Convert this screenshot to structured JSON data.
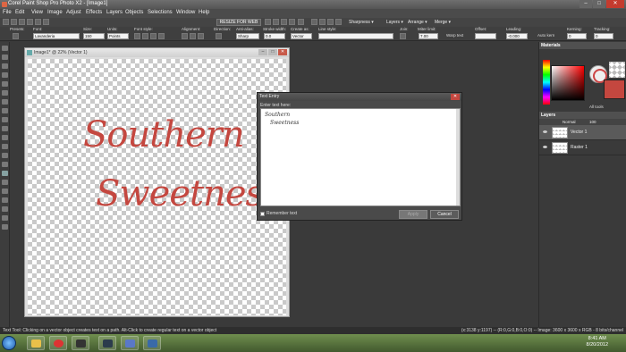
{
  "window": {
    "title": "Corel Paint Shop Pro Photo X2 - [Image1]",
    "min": "–",
    "max": "□",
    "close": "✕"
  },
  "menu": [
    "File",
    "Edit",
    "View",
    "Image",
    "Adjust",
    "Effects",
    "Layers",
    "Objects",
    "Selections",
    "Window",
    "Help"
  ],
  "toolbar1": {
    "resize_label": "RESIZE FOR WEB",
    "sharpness_label": "Sharpness ▾",
    "layers_label": "Layers ▾",
    "arrange_label": "Arrange ▾",
    "merge_label": "Merge ▾"
  },
  "tool_options": {
    "presets_label": "Presets:",
    "font_label": "Font:",
    "font_value": "Lavanderia",
    "size_label": "Size:",
    "size_value": "150",
    "units_label": "Units:",
    "units_value": "Points",
    "font_style_label": "Font style:",
    "alignment_label": "Alignment:",
    "direction_label": "Direction:",
    "antialias_label": "Anti-alias:",
    "antialias_value": "Sharp",
    "stroke_width_label": "Stroke width:",
    "stroke_width_value": "0.0",
    "create_as_label": "Create as:",
    "create_as_value": "Vector",
    "line_style_label": "Line style:",
    "join_label": "Join:",
    "miter_limit_label": "Miter limit:",
    "miter_limit_value": "7.00",
    "warp_text_label": "Warp text",
    "offset_label": "Offset:",
    "leading_label": "Leading:",
    "leading_value": "-0.000",
    "auto_kern_label": "Auto kern",
    "kerning_label": "Kerning:",
    "kerning_value": "0",
    "tracking_label": "Tracking:",
    "tracking_value": "0"
  },
  "document": {
    "title": "Image1* @ 22% (Vector 1)",
    "line1": "Southern",
    "line2": "Sweetness"
  },
  "text_entry": {
    "title": "Text Entry",
    "prompt": "Enter text here:",
    "text_line1": "Southern",
    "text_line2": "Sweetness",
    "remember_label": "Remember text",
    "apply_label": "Apply",
    "cancel_label": "Cancel",
    "close": "✕"
  },
  "materials": {
    "title": "Materials",
    "all_tools_label": "All tools"
  },
  "layers": {
    "title": "Layers",
    "blend_value": "Normal",
    "opacity_value": "100",
    "items": [
      {
        "name": "Vector 1",
        "selected": true
      },
      {
        "name": "Raster 1",
        "selected": false
      }
    ]
  },
  "status": {
    "hint": "Text Tool: Clicking on a vector object creates text on a path. Alt-Click to create regular text on a vector object",
    "info": "(x:3138 y:1197) -- (R:0,G:0,B:0,O:0) -- Image: 3600 x 3600 x RGB - 8 bits/channel"
  },
  "taskbar": {
    "time": "8:41 AM",
    "date": "8/20/2012"
  },
  "colors": {
    "accent_red": "#c4473f"
  }
}
